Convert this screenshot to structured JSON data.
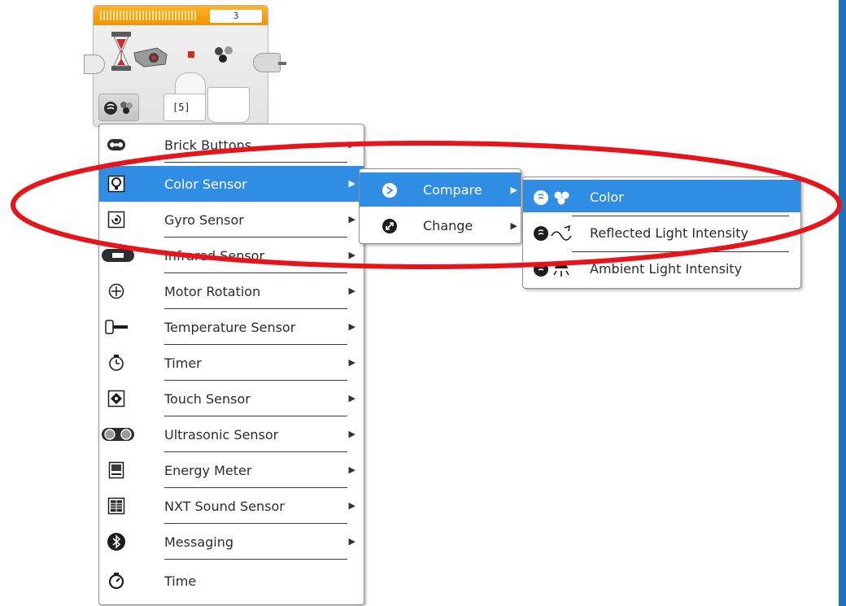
{
  "block": {
    "number": "3",
    "param_value": "[5]"
  },
  "main_menu": {
    "items": [
      {
        "label": "Brick Buttons",
        "icon": "brick-buttons-icon",
        "has_submenu": true
      },
      {
        "label": "Color Sensor",
        "icon": "color-sensor-icon",
        "has_submenu": true,
        "selected": true
      },
      {
        "label": "Gyro Sensor",
        "icon": "gyro-sensor-icon",
        "has_submenu": true
      },
      {
        "label": "Infrared Sensor",
        "icon": "infrared-sensor-icon",
        "has_submenu": true
      },
      {
        "label": "Motor Rotation",
        "icon": "motor-rotation-icon",
        "has_submenu": true
      },
      {
        "label": "Temperature Sensor",
        "icon": "temperature-sensor-icon",
        "has_submenu": true
      },
      {
        "label": "Timer",
        "icon": "timer-icon",
        "has_submenu": true
      },
      {
        "label": "Touch Sensor",
        "icon": "touch-sensor-icon",
        "has_submenu": true
      },
      {
        "label": "Ultrasonic Sensor",
        "icon": "ultrasonic-sensor-icon",
        "has_submenu": true
      },
      {
        "label": "Energy Meter",
        "icon": "energy-meter-icon",
        "has_submenu": true
      },
      {
        "label": "NXT Sound Sensor",
        "icon": "nxt-sound-sensor-icon",
        "has_submenu": true
      },
      {
        "label": "Messaging",
        "icon": "bluetooth-icon",
        "has_submenu": true
      },
      {
        "label": "Time",
        "icon": "time-icon",
        "has_submenu": false
      }
    ]
  },
  "sub_menu": {
    "items": [
      {
        "label": "Compare",
        "icon": "compare-icon",
        "selected": true
      },
      {
        "label": "Change",
        "icon": "change-icon",
        "selected": false
      }
    ]
  },
  "mode_menu": {
    "items": [
      {
        "label": "Color",
        "icon": "color-mode-icon",
        "selected": true
      },
      {
        "label": "Reflected Light Intensity",
        "icon": "reflected-light-icon",
        "selected": false
      },
      {
        "label": "Ambient Light Intensity",
        "icon": "ambient-light-icon",
        "selected": false
      }
    ]
  },
  "colors": {
    "selection": "#2f8de4",
    "annotation": "#e8141b",
    "block_header": "#f7a114",
    "window_border": "#1e73be"
  }
}
